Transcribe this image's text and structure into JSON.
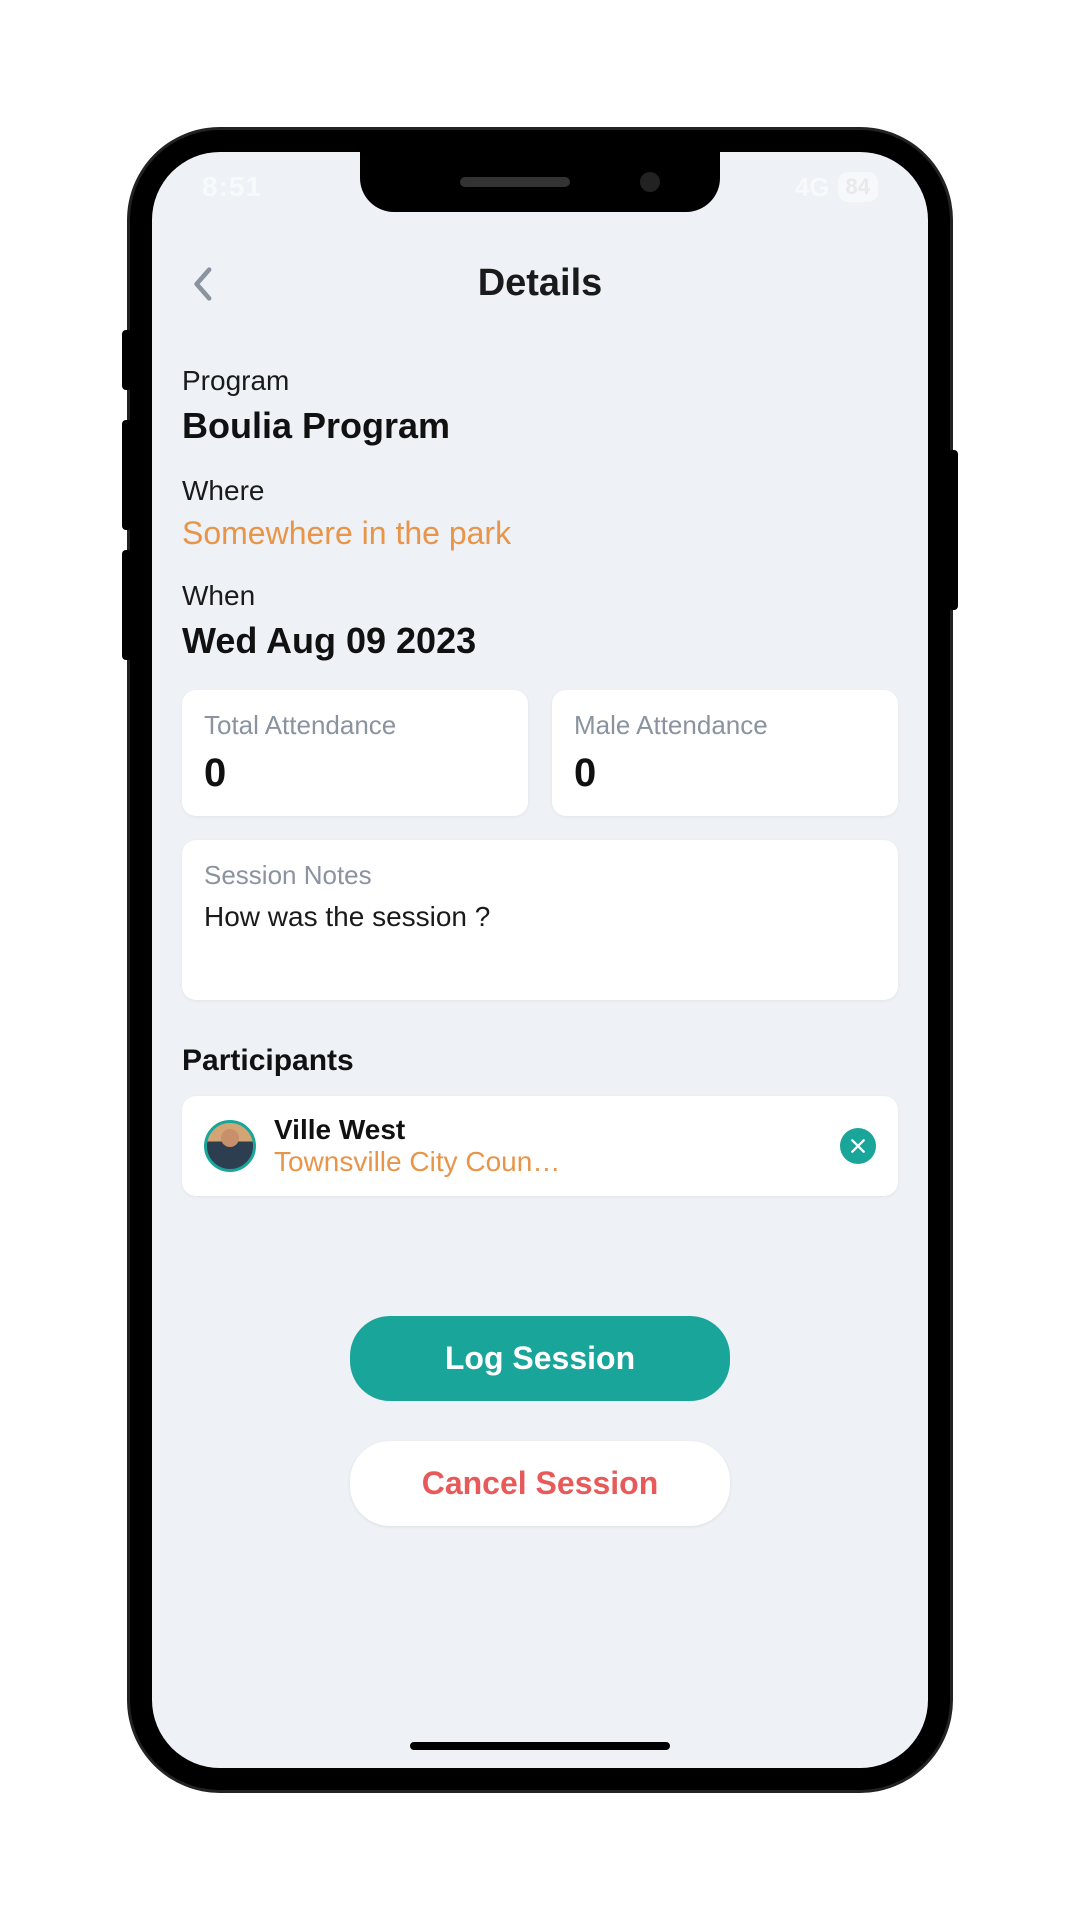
{
  "status": {
    "time": "8:51",
    "network": "4G",
    "battery": "84"
  },
  "header": {
    "title": "Details"
  },
  "fields": {
    "program_label": "Program",
    "program_value": "Boulia Program",
    "where_label": "Where",
    "where_value": "Somewhere in the park",
    "when_label": "When",
    "when_value": "Wed Aug 09 2023"
  },
  "attendance": {
    "total_label": "Total Attendance",
    "total_value": "0",
    "male_label": "Male Attendance",
    "male_value": "0"
  },
  "notes": {
    "label": "Session Notes",
    "placeholder": "How was the session ?"
  },
  "participants": {
    "title": "Participants",
    "items": [
      {
        "name": "Ville West",
        "org": "Townsville City Coun…"
      }
    ]
  },
  "actions": {
    "log": "Log Session",
    "cancel": "Cancel Session"
  }
}
